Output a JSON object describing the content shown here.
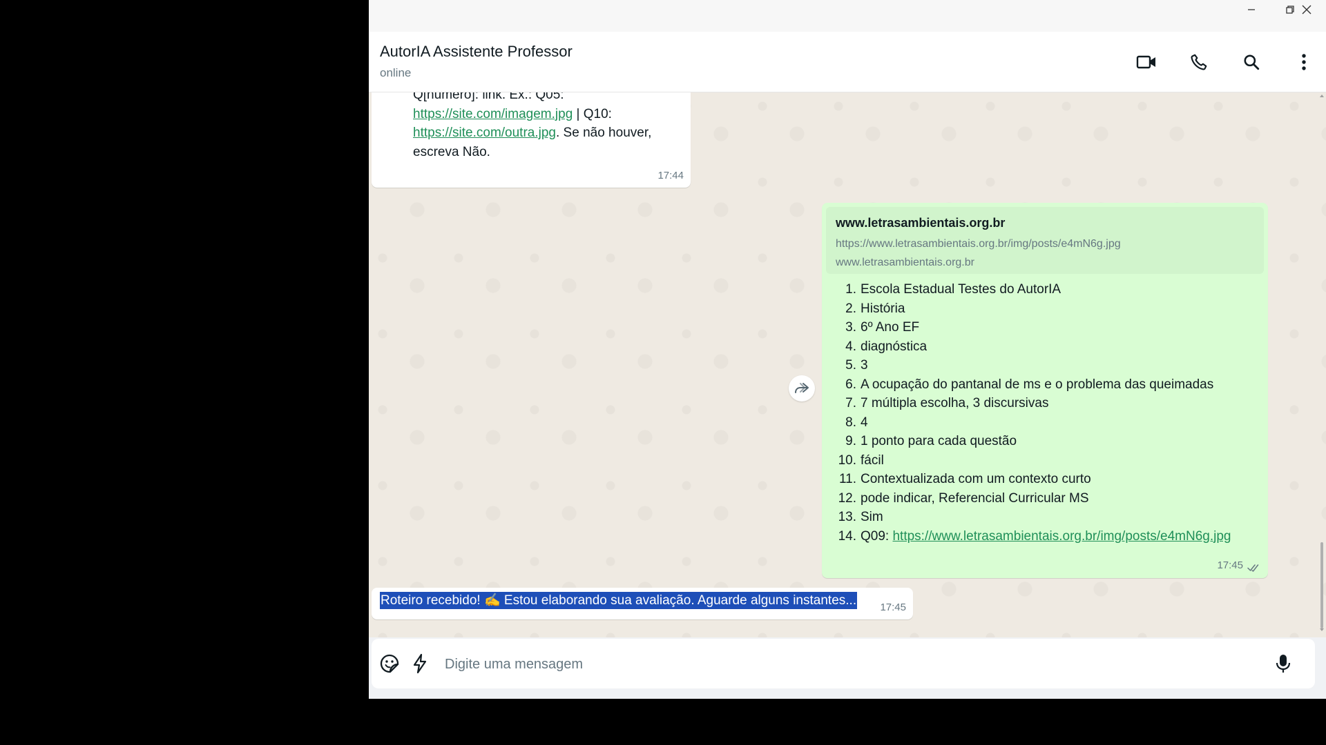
{
  "header": {
    "contact_name": "AutorIA Assistente Professor",
    "status": "online"
  },
  "messages": {
    "msg1": {
      "line1": "Q[número]: link. Ex.: Q05:",
      "link1": "https://site.com/imagem.jpg",
      "mid": " | Q10:",
      "link2": "https://site.com/outra.jpg",
      "tail1": ". Se não houver,",
      "tail2": "escreva Não.",
      "time": "17:44"
    },
    "msg2": {
      "preview_title": "www.letrasambientais.org.br",
      "preview_url": "https://www.letrasambientais.org.br/img/posts/e4mN6g.jpg",
      "preview_domain": "www.letrasambientais.org.br",
      "items": [
        {
          "n": "1.",
          "text": "Escola Estadual Testes do AutorIA"
        },
        {
          "n": "2.",
          "text": "História"
        },
        {
          "n": "3.",
          "text": "6º Ano EF"
        },
        {
          "n": "4.",
          "text": "diagnóstica"
        },
        {
          "n": "5.",
          "text": "3"
        },
        {
          "n": "6.",
          "text": "A ocupação do pantanal de ms e o problema das queimadas"
        },
        {
          "n": "7.",
          "text": "7 múltipla escolha, 3 discursivas"
        },
        {
          "n": "8.",
          "text": "4"
        },
        {
          "n": "9.",
          "text": "1 ponto para cada questão"
        },
        {
          "n": "10.",
          "text": "fácil"
        },
        {
          "n": "11.",
          "text": "Contextualizada com um contexto curto"
        },
        {
          "n": "12.",
          "text": "pode indicar, Referencial Curricular MS"
        },
        {
          "n": "13.",
          "text": "Sim"
        }
      ],
      "item14_num": "14.",
      "item14_prefix": "Q09: ",
      "item14_link": "https://www.letrasambientais.org.br/img/posts/e4mN6g.jpg",
      "time": "17:45",
      "status_icon": "double-check-icon"
    },
    "msg3": {
      "text": "Roteiro recebido! ✍️ Estou elaborando sua avaliação. Aguarde alguns instantes...",
      "time": "17:45"
    }
  },
  "composer": {
    "placeholder": "Digite uma mensagem"
  },
  "colors": {
    "incoming_bubble": "#ffffff",
    "outgoing_bubble": "#d9fdd3",
    "selection": "#1e4fb8",
    "link": "#1f8f58"
  }
}
